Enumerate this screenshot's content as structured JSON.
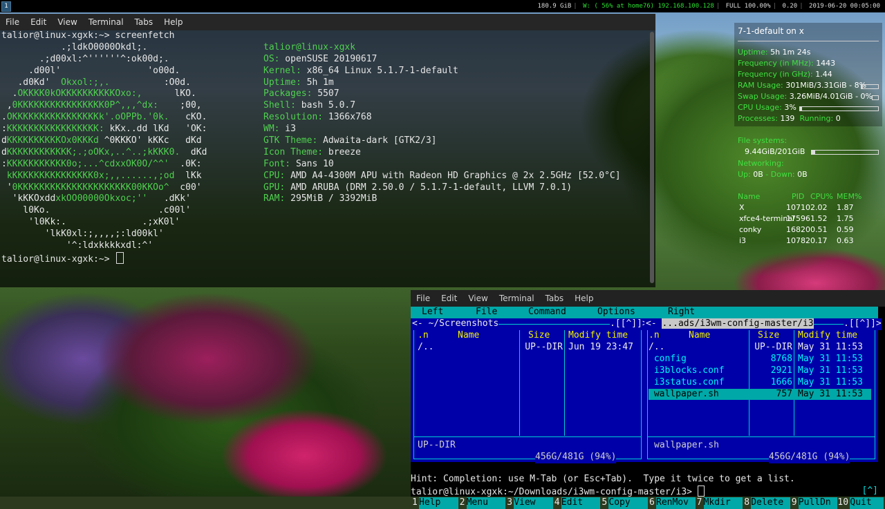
{
  "topbar": {
    "workspace": "1",
    "status": {
      "disk": "180.9 GiB",
      "wifi": "W: ( 56% at home76) 192.168.100.128",
      "battery": "FULL 100.00%",
      "load": "0.20",
      "datetime": "2019-06-20 00:05:00"
    }
  },
  "term1": {
    "menu": [
      "File",
      "Edit",
      "View",
      "Terminal",
      "Tabs",
      "Help"
    ],
    "prompt": "talior@linux-xgxk:~> screenfetch",
    "logo": [
      "           .;ldkO0000Okdl;.",
      "       .;d00xl:^''''''^:ok00d;.",
      "     .d00l'                'o00d.",
      "   .d0Kd'  Okxol:;,.          :O0d.",
      "  .OKKKK0kOKKKKKKKKKKOxo:,      lKO.",
      " ,0KKKKKKKKKKKKKKKK0P^,,,^dx:    ;00,",
      ".OKKKKKKKKKKKKKKKKk'.oOPPb.'0k.   cKO.",
      ":KKKKKKKKKKKKKKKKK: kKx..dd lKd   'OK:",
      "dKKKKKKKKKKOx0KKKd ^0KKKO' kKKc   dKd",
      "dKKKKKKKKKKKK;.;oOKx,..^..;kKKK0.  dKd",
      ":KKKKKKKKKKK0o;...^cdxxOK0O/^^'  .0K:",
      " kKKKKKKKKKKKKKKK0x;,,......,;od  lKk",
      " '0KKKKKKKKKKKKKKKKKKKKK00KKOo^  c00'",
      "  'kKKOxddxkOO00000Okxoc;''   .dKk'",
      "    l0Ko.                    .c00l'",
      "     'l0Kk:.              .;xK0l'",
      "        'lkK0xl:;,,,,;:ld00kl'",
      "            '^:ldxkkkkxdl:^'"
    ],
    "info": [
      {
        "key": "talior@linux-xgxk",
        "val": ""
      },
      {
        "key": "OS:",
        "val": " openSUSE 20190617"
      },
      {
        "key": "Kernel:",
        "val": " x86_64 Linux 5.1.7-1-default"
      },
      {
        "key": "Uptime:",
        "val": " 5h 1m"
      },
      {
        "key": "Packages:",
        "val": " 5507"
      },
      {
        "key": "Shell:",
        "val": " bash 5.0.7"
      },
      {
        "key": "Resolution:",
        "val": " 1366x768"
      },
      {
        "key": "WM:",
        "val": " i3"
      },
      {
        "key": "GTK Theme:",
        "val": " Adwaita-dark [GTK2/3]"
      },
      {
        "key": "Icon Theme:",
        "val": " breeze"
      },
      {
        "key": "Font:",
        "val": " Sans 10"
      },
      {
        "key": "CPU:",
        "val": " AMD A4-4300M APU with Radeon HD Graphics @ 2x 2.5GHz [52.0°C]"
      },
      {
        "key": "GPU:",
        "val": " AMD ARUBA (DRM 2.50.0 / 5.1.7-1-default, LLVM 7.0.1)"
      },
      {
        "key": "RAM:",
        "val": " 295MiB / 3392MiB"
      }
    ],
    "prompt2": "talior@linux-xgxk:~> "
  },
  "conky": {
    "title": "7-1-default on x",
    "uptime_label": "Uptime:",
    "uptime": "5h 1m 24s",
    "freq_mhz_label": "Frequency (in MHz):",
    "freq_mhz": "1443",
    "freq_ghz_label": "Frequency (in GHz):",
    "freq_ghz": "1.44",
    "ram_label": "RAM Usage:",
    "ram": "301MiB/3.31GiB - 8%",
    "ram_frac": 0.08,
    "swap_label": "Swap Usage:",
    "swap": "3.26MiB/4.01GiB - 0%",
    "swap_frac": 0.0,
    "cpu_label": "CPU Usage:",
    "cpu": "3%",
    "cpu_frac": 0.03,
    "processes_label": "Processes:",
    "processes": "139",
    "running_label": "Running:",
    "running": "0",
    "fs_label": "File systems:",
    "fs": "9.44GiB/201GiB",
    "fs_frac": 0.05,
    "net_label": "Networking:",
    "up_label": "Up:",
    "up": "0B",
    "down_label": "- Down:",
    "down": "0B",
    "proc_headers": [
      "Name",
      "PID",
      "CPU%",
      "MEM%"
    ],
    "procs": [
      [
        "X",
        "10710",
        "2.02",
        "1.87"
      ],
      [
        "xfce4-terminal",
        "17596",
        "1.52",
        "1.75"
      ],
      [
        "conky",
        "16820",
        "0.51",
        "0.59"
      ],
      [
        "i3",
        "10782",
        "0.17",
        "0.63"
      ]
    ]
  },
  "term2": {
    "menu": [
      "File",
      "Edit",
      "View",
      "Terminal",
      "Tabs",
      "Help"
    ],
    "mc_menu": [
      "Left",
      "File",
      "Command",
      "Options",
      "Right"
    ],
    "left": {
      "path": "~/Screenshots",
      "cols": [
        ".n",
        "Name",
        "Size",
        "Modify time"
      ],
      "rows": [
        [
          "/..",
          "UP--DIR",
          "Jun 19 23:47"
        ]
      ],
      "status": "UP--DIR",
      "free": "456G/481G (94%)"
    },
    "right": {
      "path": "...ads/i3wm-config-master/i3",
      "cols": [
        ".n",
        "Name",
        "Size",
        "Modify time"
      ],
      "rows": [
        [
          "/..",
          "UP--DIR",
          "May 31 11:53"
        ],
        [
          " config",
          "8768",
          "May 31 11:53"
        ],
        [
          " i3blocks.conf",
          "2921",
          "May 31 11:53"
        ],
        [
          " i3status.conf",
          "1666",
          "May 31 11:53"
        ],
        [
          " wallpaper.sh",
          "757",
          "May 31 11:53"
        ]
      ],
      "status": "wallpaper.sh",
      "free": "456G/481G (94%)"
    },
    "scroll_mark": "[^]",
    "hint": "Hint: Completion: use M-Tab (or Esc+Tab).  Type it twice to get a list.",
    "cmd": "talior@linux-xgxk:~/Downloads/i3wm-config-master/i3> ",
    "fkeys": [
      [
        "1",
        "Help"
      ],
      [
        "2",
        "Menu"
      ],
      [
        "3",
        "View"
      ],
      [
        "4",
        "Edit"
      ],
      [
        "5",
        "Copy"
      ],
      [
        "6",
        "RenMov"
      ],
      [
        "7",
        "Mkdir"
      ],
      [
        "8",
        "Delete"
      ],
      [
        "9",
        "PullDn"
      ],
      [
        "10",
        "Quit"
      ]
    ]
  }
}
